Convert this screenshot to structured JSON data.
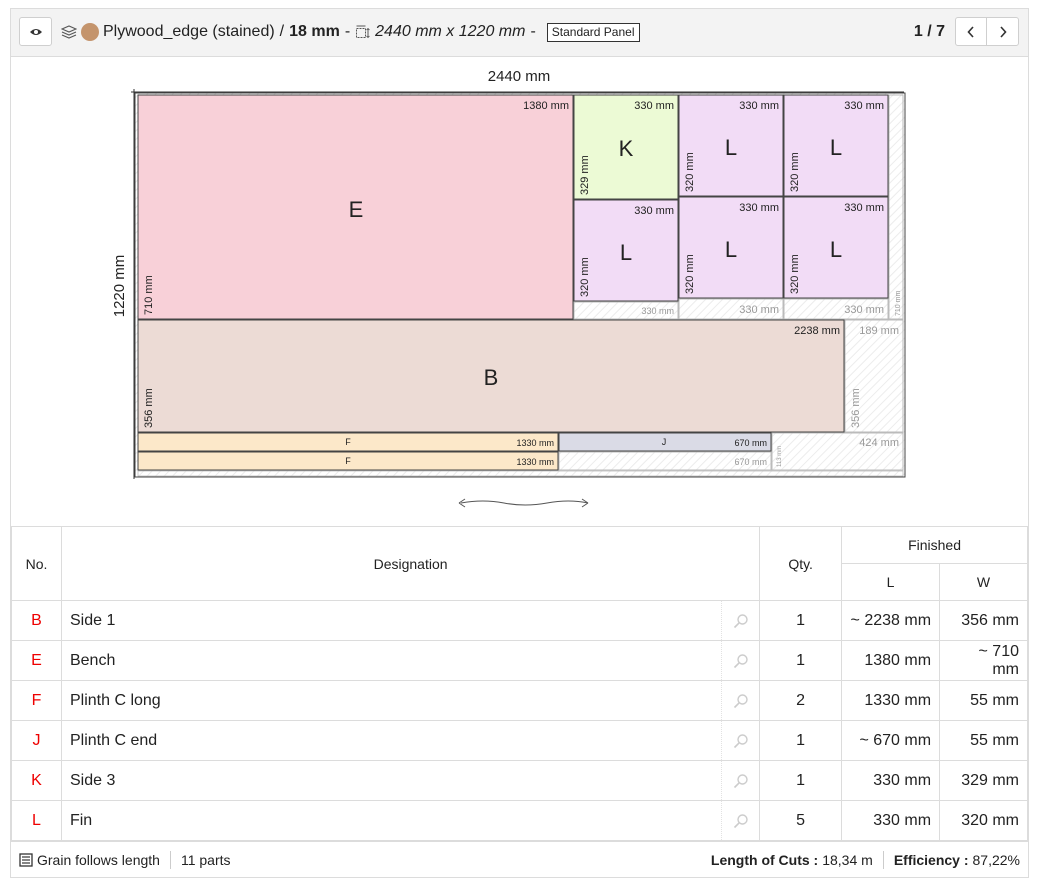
{
  "header": {
    "material": "Plywood_edge (stained)",
    "separator": "/",
    "thickness": "18 mm",
    "dash1": "-",
    "dimensions": "2440 mm x 1220 mm",
    "dash2": "-",
    "badge": "Standard Panel",
    "page_indicator": "1 / 7",
    "material_color": "#c4946c"
  },
  "board": {
    "width_label": "2440 mm",
    "height_label": "1220 mm",
    "colors": {
      "E": "#f8d0d8",
      "K": "#ecfad5",
      "L": "#f2dcf6",
      "B": "#ecdbd5",
      "F": "#fce8c9",
      "J": "#dadbe6"
    },
    "parts": [
      {
        "label": "E",
        "length": "1380 mm",
        "width": "710 mm"
      },
      {
        "label": "K",
        "length": "330 mm",
        "width": "329 mm"
      },
      {
        "label": "L",
        "length": "330 mm",
        "width": "320 mm"
      },
      {
        "label": "L",
        "length": "330 mm",
        "width": "320 mm"
      },
      {
        "label": "L",
        "length": "330 mm",
        "width": "320 mm"
      },
      {
        "label": "L",
        "length": "330 mm",
        "width": "320 mm"
      },
      {
        "label": "L",
        "length": "330 mm",
        "width": "320 mm"
      },
      {
        "label": "B",
        "length": "2238 mm",
        "width": "356 mm"
      },
      {
        "label": "F",
        "length": "1330 mm"
      },
      {
        "label": "F",
        "length": "1330 mm"
      },
      {
        "label": "J",
        "length": "670 mm"
      }
    ],
    "offcuts": [
      {
        "length": "330 mm"
      },
      {
        "length": "330 mm"
      },
      {
        "length": "330 mm"
      },
      {
        "width": "710 mm"
      },
      {
        "length": "189 mm",
        "width": "356 mm"
      },
      {
        "length": "424 mm",
        "width": "113 mm"
      },
      {
        "length": "670 mm"
      }
    ]
  },
  "table": {
    "headers": {
      "no": "No.",
      "designation": "Designation",
      "qty": "Qty.",
      "finished": "Finished",
      "l": "L",
      "w": "W"
    },
    "rows": [
      {
        "no": "B",
        "designation": "Side 1",
        "qty": "1",
        "l": "~ 2238 mm",
        "w": "356 mm"
      },
      {
        "no": "E",
        "designation": "Bench",
        "qty": "1",
        "l": "1380 mm",
        "w": "~ 710 mm"
      },
      {
        "no": "F",
        "designation": "Plinth C long",
        "qty": "2",
        "l": "1330 mm",
        "w": "55 mm"
      },
      {
        "no": "J",
        "designation": "Plinth C end",
        "qty": "1",
        "l": "~ 670 mm",
        "w": "55 mm"
      },
      {
        "no": "K",
        "designation": "Side 3",
        "qty": "1",
        "l": "330 mm",
        "w": "329 mm"
      },
      {
        "no": "L",
        "designation": "Fin",
        "qty": "5",
        "l": "330 mm",
        "w": "320 mm"
      }
    ]
  },
  "footer": {
    "grain": "Grain follows length",
    "parts": "11 parts",
    "cuts_label": "Length of Cuts :",
    "cuts_value": "18,34 m",
    "efficiency_label": "Efficiency :",
    "efficiency_value": "87,22%"
  }
}
